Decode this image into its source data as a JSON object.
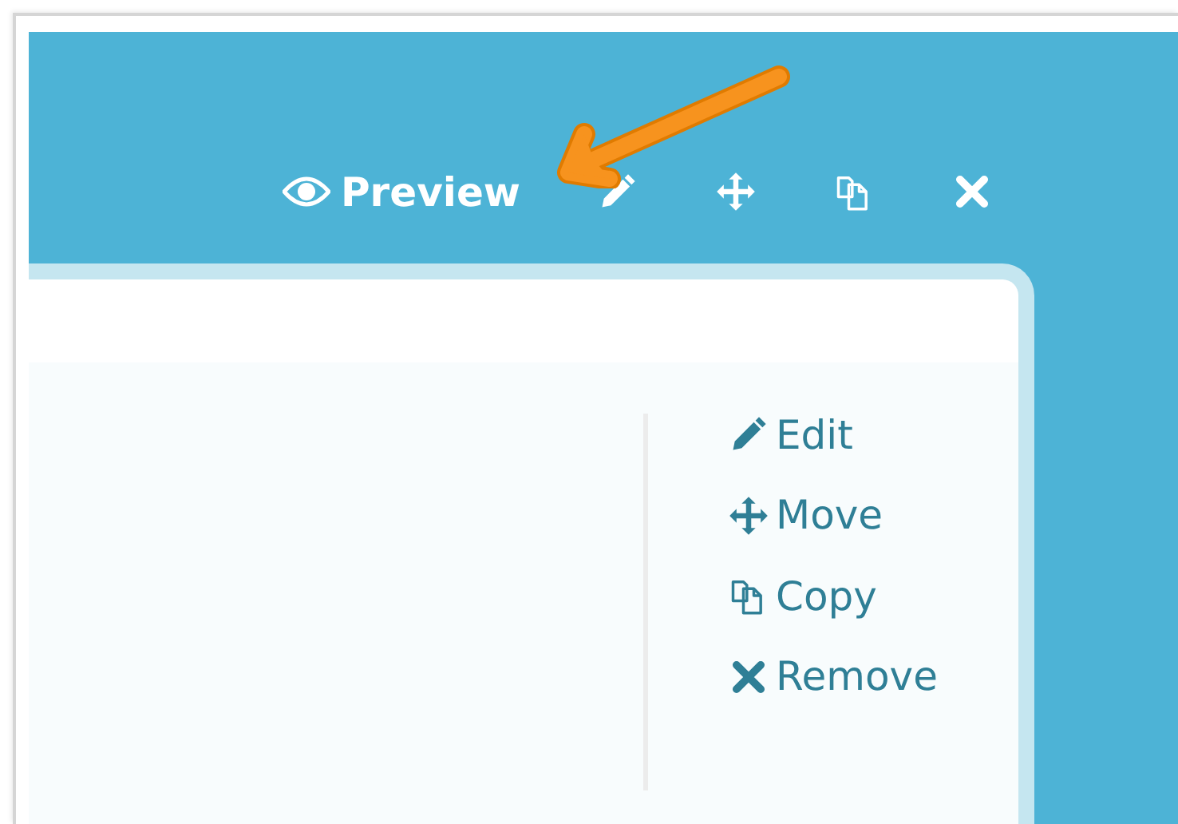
{
  "toolbar": {
    "preview": {
      "label": "Preview"
    },
    "icon_buttons": [
      {
        "kind": "edit"
      },
      {
        "kind": "move"
      },
      {
        "kind": "copy"
      },
      {
        "kind": "remove"
      }
    ]
  },
  "actions": [
    {
      "kind": "edit",
      "label": "Edit"
    },
    {
      "kind": "move",
      "label": "Move"
    },
    {
      "kind": "copy",
      "label": "Copy"
    },
    {
      "kind": "remove",
      "label": "Remove"
    }
  ]
}
